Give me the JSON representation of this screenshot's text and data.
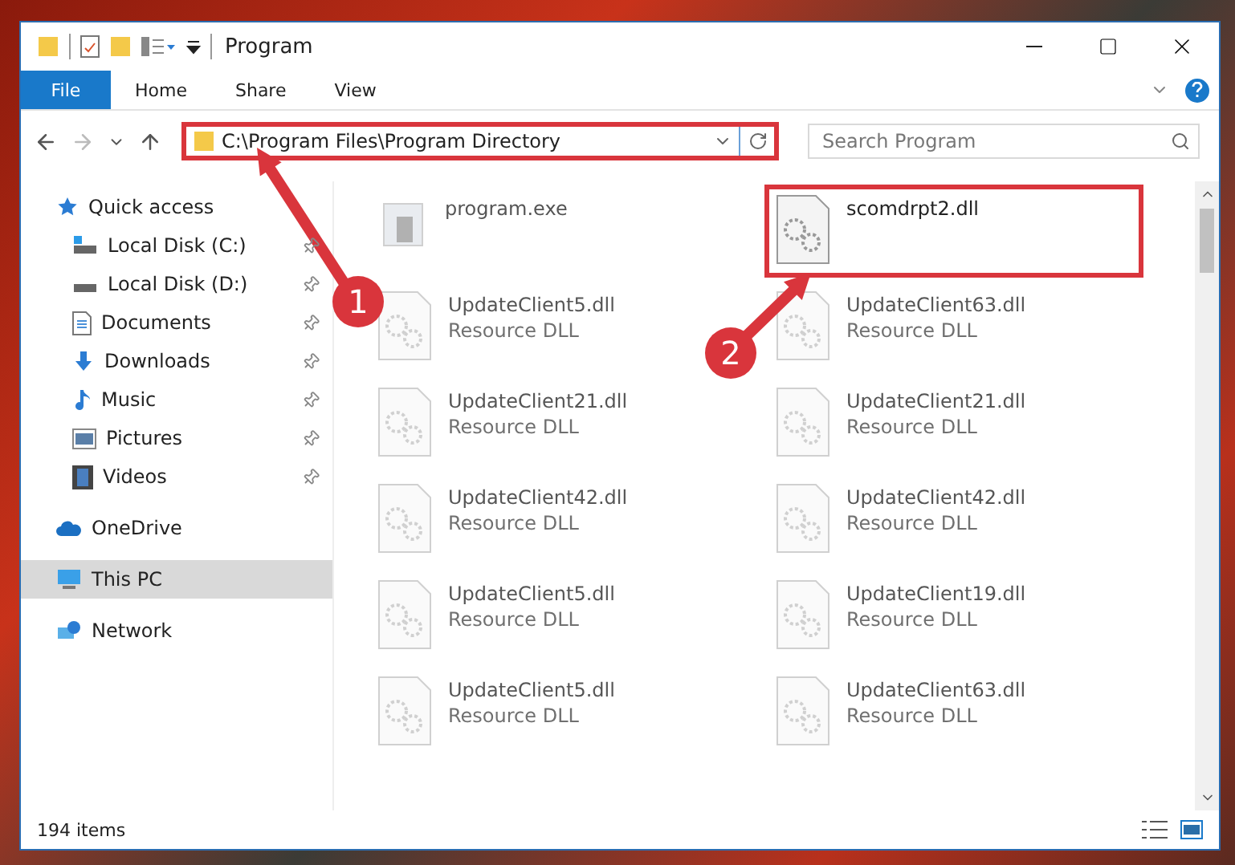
{
  "window": {
    "title": "Program"
  },
  "ribbon": {
    "tabs": [
      {
        "label": "File",
        "kind": "menu"
      },
      {
        "label": "Home",
        "kind": "tab"
      },
      {
        "label": "Share",
        "kind": "tab"
      },
      {
        "label": "View",
        "kind": "tab"
      }
    ]
  },
  "address": {
    "path": "C:\\Program Files\\Program Directory",
    "highlighted": true
  },
  "search": {
    "placeholder": "Search Program"
  },
  "sidebar": {
    "items": [
      {
        "label": "Quick access",
        "kind": "star",
        "selected": false,
        "children": [
          {
            "label": "Local Disk (C:)",
            "kind": "system-drive",
            "pinned": true,
            "selected": false
          },
          {
            "label": "Local Disk (D:)",
            "kind": "drive",
            "pinned": true,
            "selected": false
          },
          {
            "label": "Documents",
            "kind": "document",
            "pinned": true,
            "selected": false
          },
          {
            "label": "Downloads",
            "kind": "download",
            "pinned": true,
            "selected": false
          },
          {
            "label": "Music",
            "kind": "music",
            "pinned": true,
            "selected": false
          },
          {
            "label": "Pictures",
            "kind": "picture",
            "pinned": true,
            "selected": false
          },
          {
            "label": "Videos",
            "kind": "video",
            "pinned": true,
            "selected": false
          }
        ]
      },
      {
        "label": "OneDrive",
        "kind": "cloud",
        "selected": false
      },
      {
        "label": "This PC",
        "kind": "computer",
        "selected": true
      },
      {
        "label": "Network",
        "kind": "network",
        "selected": false
      }
    ]
  },
  "files": [
    {
      "name": "program.exe",
      "kind": "exe",
      "dimmed": true,
      "highlighted": false
    },
    {
      "name": "scomdrpt2.dll",
      "kind": "dll",
      "dimmed": false,
      "highlighted": true
    },
    {
      "name": "UpdateClient5.dll",
      "type": "Resource DLL",
      "kind": "dll",
      "dimmed": true,
      "highlighted": false
    },
    {
      "name": "UpdateClient63.dll",
      "type": "Resource DLL",
      "kind": "dll",
      "dimmed": true,
      "highlighted": false
    },
    {
      "name": "UpdateClient21.dll",
      "type": "Resource DLL",
      "kind": "dll",
      "dimmed": true,
      "highlighted": false
    },
    {
      "name": "UpdateClient21.dll",
      "type": "Resource DLL",
      "kind": "dll",
      "dimmed": true,
      "highlighted": false
    },
    {
      "name": "UpdateClient42.dll",
      "type": "Resource DLL",
      "kind": "dll",
      "dimmed": true,
      "highlighted": false
    },
    {
      "name": "UpdateClient42.dll",
      "type": "Resource DLL",
      "kind": "dll",
      "dimmed": true,
      "highlighted": false
    },
    {
      "name": "UpdateClient5.dll",
      "type": "Resource DLL",
      "kind": "dll",
      "dimmed": true,
      "highlighted": false
    },
    {
      "name": "UpdateClient19.dll",
      "type": "Resource DLL",
      "kind": "dll",
      "dimmed": true,
      "highlighted": false
    },
    {
      "name": "UpdateClient5.dll",
      "type": "Resource DLL",
      "kind": "dll",
      "dimmed": true,
      "highlighted": false
    },
    {
      "name": "UpdateClient63.dll",
      "type": "Resource DLL",
      "kind": "dll",
      "dimmed": true,
      "highlighted": false
    }
  ],
  "status_bar": {
    "count": "194 items"
  },
  "annotations": [
    {
      "label": "1"
    },
    {
      "label": "2"
    }
  ]
}
